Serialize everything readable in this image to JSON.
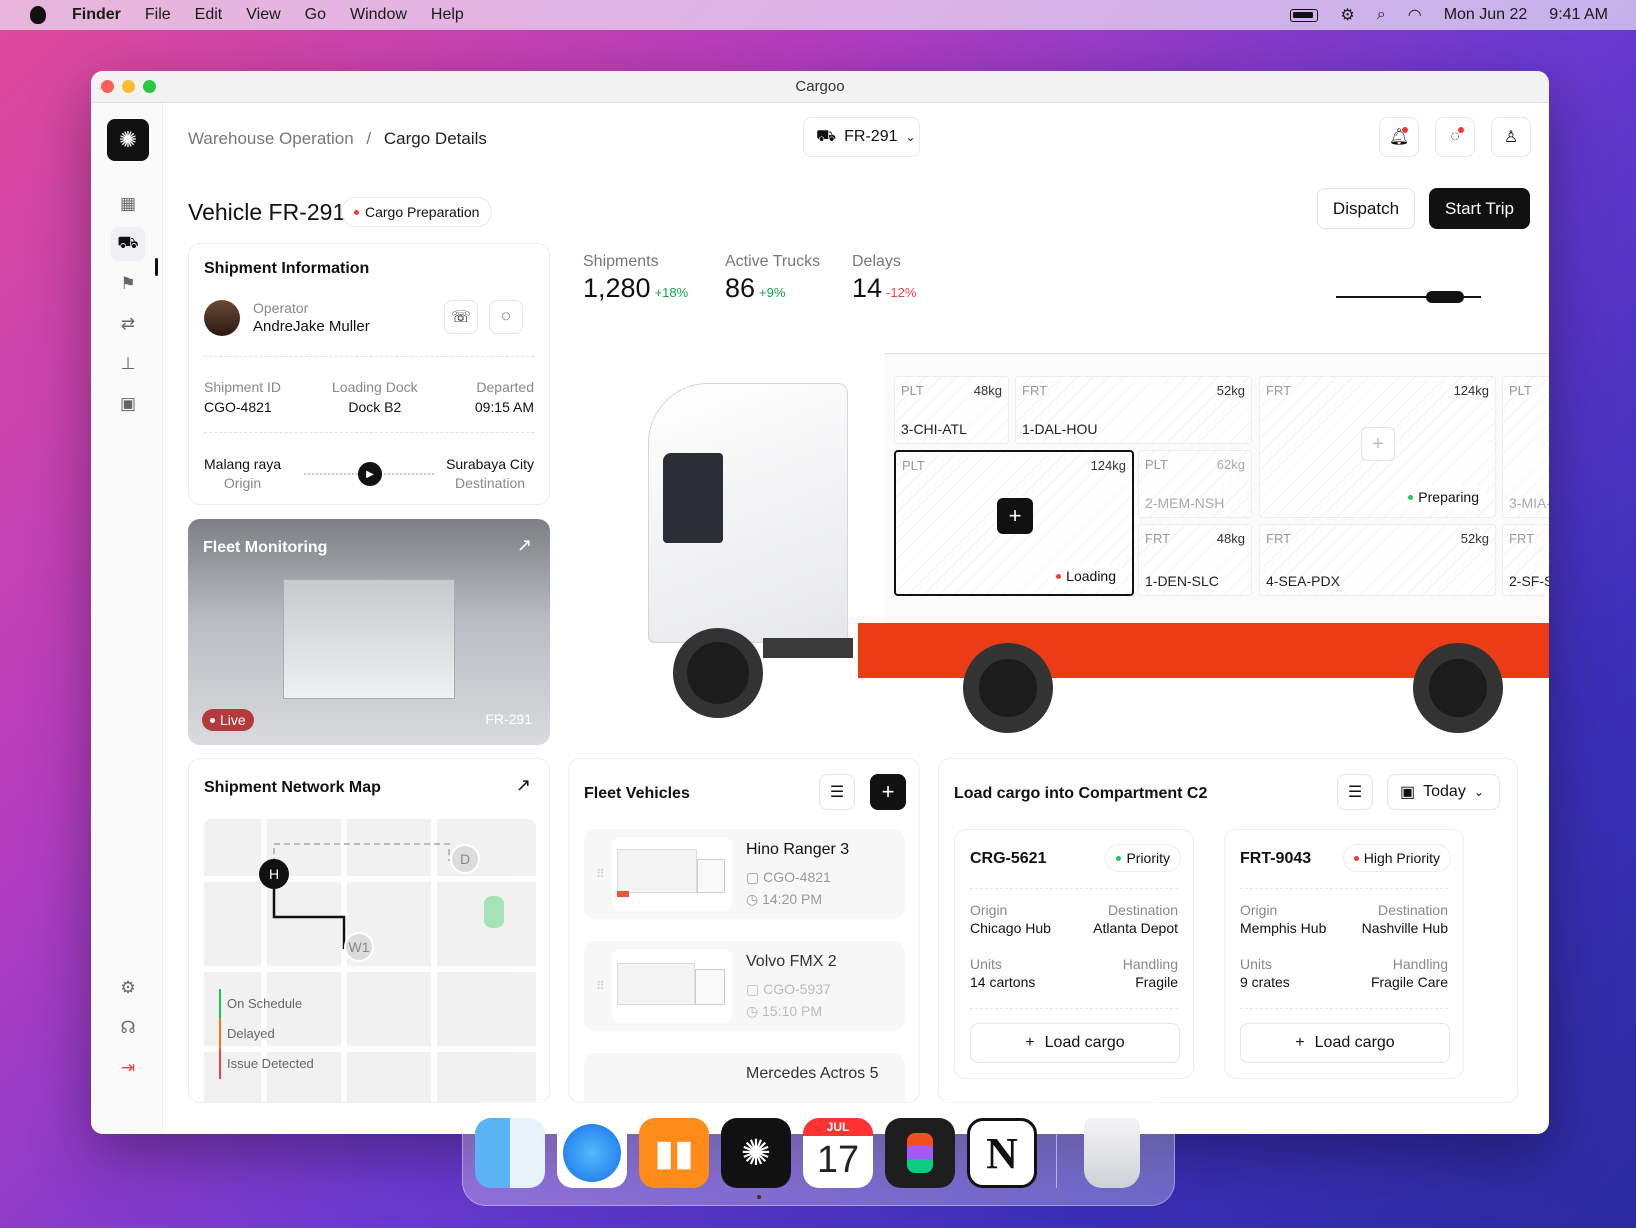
{
  "menubar": {
    "app": "Finder",
    "items": [
      "File",
      "Edit",
      "View",
      "Go",
      "Window",
      "Help"
    ],
    "date": "Mon Jun 22",
    "time": "9:41 AM"
  },
  "window": {
    "title": "Cargoo"
  },
  "breadcrumb": {
    "parent": "Warehouse Operation",
    "separator": "/",
    "current": "Cargo Details"
  },
  "vehicle_select": {
    "value": "FR-291"
  },
  "header": {
    "title": "Vehicle FR-291",
    "status": "Cargo Preparation",
    "dispatch": "Dispatch",
    "start": "Start Trip"
  },
  "shipment_info": {
    "title": "Shipment Information",
    "operator_label": "Operator",
    "operator_name": "AndreJake Muller",
    "id_label": "Shipment ID",
    "id_value": "CGO-4821",
    "dock_label": "Loading Dock",
    "dock_value": "Dock B2",
    "departed_label": "Departed",
    "departed_value": "09:15 AM",
    "origin": "Malang raya",
    "origin_label": "Origin",
    "destination": "Surabaya City",
    "destination_label": "Destination"
  },
  "fleet_monitoring": {
    "title": "Fleet Monitoring",
    "live": "Live",
    "vehicle": "FR-291"
  },
  "network_map": {
    "title": "Shipment Network Map",
    "nodes": [
      "H",
      "W1",
      "D"
    ],
    "legend": [
      "On Schedule",
      "Delayed",
      "Issue Detected"
    ],
    "legend_colors": [
      "#22c55e",
      "#f97316",
      "#ef4444"
    ]
  },
  "stats": [
    {
      "label": "Shipments",
      "value": "1,280",
      "delta": "+18%",
      "color": "#16a34a"
    },
    {
      "label": "Active Trucks",
      "value": "86",
      "delta": "+9%",
      "color": "#16a34a"
    },
    {
      "label": "Delays",
      "value": "14",
      "delta": "-12%",
      "color": "#ef4444"
    }
  ],
  "compartments": {
    "s1": {
      "type": "PLT",
      "weight": "48kg",
      "code": "3-CHI-ATL"
    },
    "s2": {
      "type": "FRT",
      "weight": "52kg",
      "code": "1-DAL-HOU"
    },
    "s3": {
      "type": "FRT",
      "weight": "124kg",
      "status": "Preparing"
    },
    "s4": {
      "type": "PLT",
      "code": "3-MIA-"
    },
    "s5": {
      "type": "PLT",
      "weight": "124kg",
      "status": "Loading"
    },
    "s6": {
      "type": "PLT",
      "weight": "62kg",
      "code": "2-MEM-NSH"
    },
    "s7": {
      "type": "FRT",
      "weight": "48kg",
      "code": "1-DEN-SLC"
    },
    "s8": {
      "type": "FRT",
      "weight": "52kg",
      "code": "4-SEA-PDX"
    },
    "s9": {
      "type": "FRT",
      "code": "2-SF-S"
    }
  },
  "fleet_vehicles": {
    "title": "Fleet Vehicles",
    "items": [
      {
        "name": "Hino Ranger 3",
        "id": "CGO-4821",
        "time": "14:20 PM"
      },
      {
        "name": "Volvo FMX 2",
        "id": "CGO-5937",
        "time": "15:10 PM"
      },
      {
        "name": "Mercedes Actros 5"
      }
    ]
  },
  "load_cargo": {
    "title": "Load cargo into Compartment C2",
    "date_filter": "Today",
    "cards": [
      {
        "id": "CRG-5621",
        "priority": "Priority",
        "priority_color": "#22c55e",
        "origin_label": "Origin",
        "origin": "Chicago Hub",
        "dest_label": "Destination",
        "dest": "Atlanta Depot",
        "units_label": "Units",
        "units": "14 cartons",
        "handling_label": "Handling",
        "handling": "Fragile",
        "button": "Load cargo"
      },
      {
        "id": "FRT-9043",
        "priority": "High Priority",
        "priority_color": "#ef4444",
        "origin_label": "Origin",
        "origin": "Memphis Hub",
        "dest_label": "Destination",
        "dest": "Nashville Hub",
        "units_label": "Units",
        "units": "9 crates",
        "handling_label": "Handling",
        "handling": "Fragile Care",
        "button": "Load cargo"
      }
    ]
  },
  "dock": {
    "calendar_month": "JUL",
    "calendar_day": "17"
  }
}
